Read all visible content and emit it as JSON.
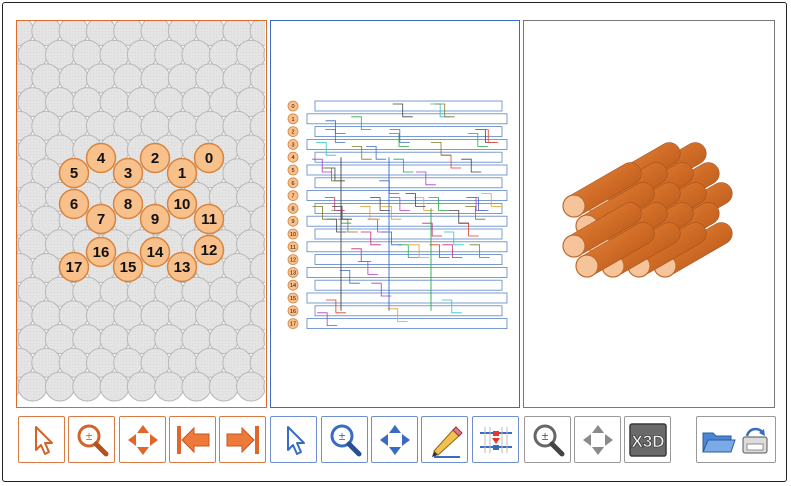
{
  "slice_panel": {
    "helix_labels": [
      "0",
      "1",
      "2",
      "3",
      "4",
      "5",
      "6",
      "7",
      "8",
      "9",
      "10",
      "11",
      "12",
      "13",
      "14",
      "15",
      "16",
      "17"
    ]
  },
  "path_panel": {
    "helix_labels": [
      "0",
      "1",
      "2",
      "3",
      "4",
      "5",
      "6",
      "7",
      "8",
      "9",
      "10",
      "11",
      "12",
      "13",
      "14",
      "15",
      "16",
      "17"
    ]
  },
  "model_panel": {
    "helix_count": 18
  },
  "toolbar": {
    "slice_tools": [
      "select-arrow-icon",
      "zoom-icon",
      "pan-icon",
      "previous-slice-icon",
      "next-slice-icon"
    ],
    "path_tools": [
      "select-arrow-icon",
      "zoom-icon",
      "pan-icon",
      "pencil-icon",
      "insert-skip-icon"
    ],
    "model_tools": [
      "zoom-icon",
      "pan-icon",
      "x3d-icon"
    ],
    "file_tools": [
      "open-folder-icon",
      "save-icon"
    ],
    "x3d_label": "X3D"
  },
  "colors": {
    "slice_accent": "#d96b2b",
    "path_accent": "#3a6bc4",
    "helix_fill": "#f8c08a",
    "cylinder": "#d5732c"
  }
}
